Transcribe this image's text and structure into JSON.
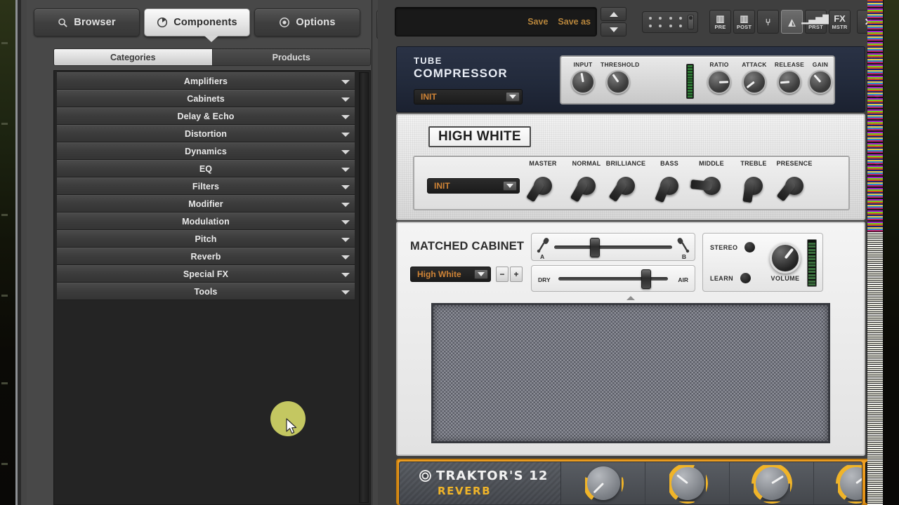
{
  "app": {
    "nav_tabs": [
      {
        "label": "Browser",
        "icon": "search-icon",
        "active": false
      },
      {
        "label": "Components",
        "icon": "clock-icon",
        "active": true
      },
      {
        "label": "Options",
        "icon": "target-icon",
        "active": false
      }
    ],
    "sub_tabs": [
      {
        "label": "Categories",
        "active": true
      },
      {
        "label": "Products",
        "active": false
      }
    ],
    "categories": [
      "Amplifiers",
      "Cabinets",
      "Delay & Echo",
      "Distortion",
      "Dynamics",
      "EQ",
      "Filters",
      "Modifier",
      "Modulation",
      "Pitch",
      "Reverb",
      "Special FX",
      "Tools"
    ]
  },
  "toolbar": {
    "preset_name": "",
    "save_label": "Save",
    "save_as_label": "Save as",
    "prev_label": "▲",
    "next_label": "▼",
    "icon_buttons": [
      {
        "name": "pre-button",
        "tag": "PRE",
        "glyph": "▥",
        "active": false
      },
      {
        "name": "post-button",
        "tag": "POST",
        "glyph": "▥",
        "active": false
      },
      {
        "name": "tuner-button",
        "tag": "",
        "glyph": "⑂",
        "active": false
      },
      {
        "name": "metronome-button",
        "tag": "",
        "glyph": "◭",
        "active": true
      },
      {
        "name": "preset-level-button",
        "tag": "PRST",
        "glyph": "▁▃▅▇",
        "active": false
      },
      {
        "name": "master-fx-button",
        "tag": "MSTR",
        "glyph": "FX",
        "active": false
      }
    ],
    "close_label": "✕",
    "minimize_label": "▬"
  },
  "modules": {
    "compressor": {
      "title_line1": "TUBE",
      "title_line2": "COMPRESSOR",
      "preset": "INIT",
      "knobs": [
        {
          "label": "INPUT",
          "angle": -10
        },
        {
          "label": "THRESHOLD",
          "angle": -35
        },
        {
          "label": "RATIO",
          "angle": 88
        },
        {
          "label": "ATTACK",
          "angle": -128
        },
        {
          "label": "RELEASE",
          "angle": -95
        },
        {
          "label": "GAIN",
          "angle": -42
        }
      ],
      "meter_segments": 12,
      "meter_lit": 12,
      "power_icon": "power-icon",
      "remove_icon": "minus-icon",
      "collapse_icon": "chevron-down-icon"
    },
    "amp": {
      "brand": "HIGH WHITE",
      "preset": "INIT",
      "knobs": [
        {
          "label": "MASTER",
          "angle": 32
        },
        {
          "label": "NORMAL",
          "angle": 30
        },
        {
          "label": "BRILLIANCE",
          "angle": 34
        },
        {
          "label": "BASS",
          "angle": 22
        },
        {
          "label": "MIDDLE",
          "angle": 96
        },
        {
          "label": "TREBLE",
          "angle": 8
        },
        {
          "label": "PRESENCE",
          "angle": 38
        }
      ],
      "power_icon": "power-icon",
      "remove_icon": "minus-icon",
      "collapse_icon": "chevron-down-icon"
    },
    "cabinet": {
      "title": "MATCHED CABINET",
      "preset": "High White",
      "stepper_minus": "−",
      "stepper_plus": "+",
      "mic_slider": {
        "left_label": "A",
        "right_label": "B",
        "value_pct": 34
      },
      "dry_slider": {
        "left_label": "DRY",
        "right_label": "AIR",
        "value_pct": 79
      },
      "stereo_label": "STEREO",
      "learn_label": "LEARN",
      "volume_label": "VOLUME",
      "volume_angle": 38,
      "meter_segments": 14,
      "meter_lit": 14,
      "power_icon": "power-icon",
      "remove_icon": "minus-icon",
      "collapse_icon": "chevron-up-icon"
    },
    "reverb": {
      "title_line1": "TRAKTOR'S 12",
      "title_line2": "REVERB",
      "logo_icon": "traktor-logo-icon",
      "knobs": [
        {
          "angle": -135,
          "arc_color": "#f0b429",
          "arc_pct": 12
        },
        {
          "angle": -52,
          "arc_color": "#f0b429",
          "arc_pct": 45
        },
        {
          "angle": 58,
          "arc_color": "#f0b429",
          "arc_pct": 70
        },
        {
          "angle": 54,
          "arc_color": "#f0b429",
          "arc_pct": 70
        }
      ],
      "accent_color": "#f0a022",
      "power_icon": "power-icon",
      "remove_icon": "minus-icon"
    }
  },
  "colors": {
    "preset_text": "#d08436",
    "save_text": "#b8863c",
    "reverb_accent": "#f0a022",
    "reverb_title_accent": "#f0b429",
    "power_ring": "#c28a2e",
    "highlight": "#d2d667"
  }
}
